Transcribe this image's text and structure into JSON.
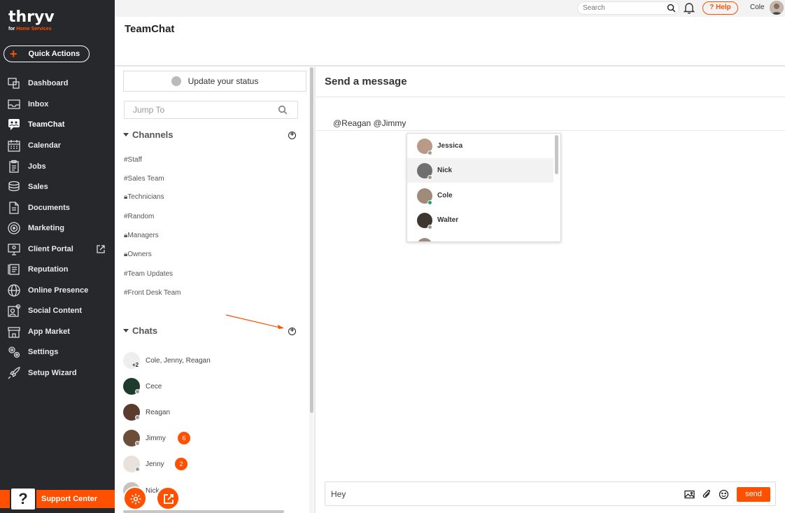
{
  "brand": {
    "name": "thryv",
    "sub_prefix": "for ",
    "sub_highlight": "Home Services",
    "accent": "#ff5000",
    "sidebar_bg": "#26282b"
  },
  "quick_actions": {
    "label": "Quick Actions"
  },
  "nav": [
    {
      "label": "Dashboard",
      "icon": "dashboard-icon"
    },
    {
      "label": "Inbox",
      "icon": "inbox-icon"
    },
    {
      "label": "TeamChat",
      "icon": "teamchat-icon",
      "active": true
    },
    {
      "label": "Calendar",
      "icon": "calendar-icon"
    },
    {
      "label": "Jobs",
      "icon": "jobs-icon"
    },
    {
      "label": "Sales",
      "icon": "sales-icon"
    },
    {
      "label": "Documents",
      "icon": "documents-icon"
    },
    {
      "label": "Marketing",
      "icon": "marketing-icon"
    },
    {
      "label": "Client Portal",
      "icon": "client-portal-icon"
    },
    {
      "label": "Reputation",
      "icon": "reputation-icon"
    },
    {
      "label": "Online Presence",
      "icon": "globe-icon"
    },
    {
      "label": "Social Content",
      "icon": "social-content-icon"
    },
    {
      "label": "App Market",
      "icon": "app-market-icon"
    },
    {
      "label": "Settings",
      "icon": "settings-icon"
    },
    {
      "label": "Setup Wizard",
      "icon": "rocket-icon"
    }
  ],
  "support": {
    "label": "Support Center",
    "icon_glyph": "?"
  },
  "topbar": {
    "search_placeholder": "Search",
    "help_label": "? Help",
    "user_name": "Cole"
  },
  "page": {
    "title": "TeamChat"
  },
  "left": {
    "status_label": "Update your status",
    "jump_placeholder": "Jump To",
    "channels_header": "Channels",
    "channels": [
      "#Staff",
      "#Sales Team",
      "Technicians",
      "#Random",
      "Managers",
      "Owners",
      "#Team Updates",
      "#Front Desk Team"
    ],
    "chats_header": "Chats",
    "chats": [
      {
        "name": "Cole, Jenny, Reagan",
        "extra": "+2"
      },
      {
        "name": "Cece"
      },
      {
        "name": "Reagan"
      },
      {
        "name": "Jimmy",
        "badge": "6"
      },
      {
        "name": "Jenny",
        "badge": "2"
      },
      {
        "name": "Nick"
      }
    ]
  },
  "right": {
    "title": "Send a message",
    "mentions": "@Reagan  @Jimmy",
    "dropdown": [
      "Jessica",
      "Nick",
      "Cole",
      "Walter"
    ],
    "composer_text": "Hey",
    "send_label": "send"
  }
}
